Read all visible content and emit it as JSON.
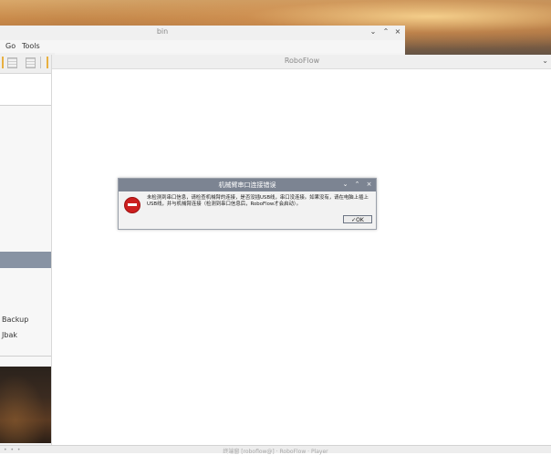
{
  "file_manager": {
    "title": "bin",
    "controls": {
      "min": "⌄",
      "max": "⌃",
      "close": "×"
    },
    "menu": [
      "Go",
      "Tools"
    ],
    "sidebar_items": [
      "Backup",
      "Jbak"
    ]
  },
  "roboflow": {
    "title": "RoboFlow",
    "chevron": "⌄"
  },
  "dialog": {
    "title": "机械臂串口连接错误",
    "controls": {
      "min": "⌄",
      "max": "⌃",
      "close": "×"
    },
    "message": "未检测到串口信息，请检查机械臂的连接，是否没插USB线，串口没连接。如果没有，请在电脑上插上USB线，并与机械臂连接（检测到串口信息后，RoboFlow才会启动）。",
    "ok_label": "✓OK"
  },
  "taskbar": {
    "dots": "• • •",
    "text": "终端窗 [roboflow@] · RoboFlow · Player"
  },
  "colors": {
    "dialog_titlebar": "#7c8492",
    "error_red": "#cc1f1f",
    "sidebar_selection": "#8893a3"
  }
}
